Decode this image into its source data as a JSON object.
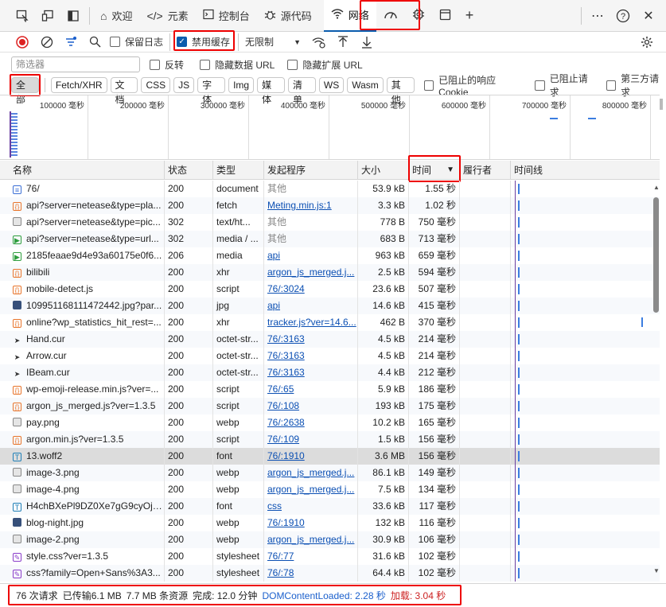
{
  "tabs": [
    {
      "label": "欢迎",
      "icon": "home-icon"
    },
    {
      "label": "元素",
      "icon": "code-icon"
    },
    {
      "label": "控制台",
      "icon": "console-icon"
    },
    {
      "label": "源代码",
      "icon": "bug-icon"
    },
    {
      "label": "网络",
      "icon": "wifi-icon",
      "active": true
    },
    {
      "label": "",
      "icon": "performance-icon"
    },
    {
      "label": "",
      "icon": "memory-chip-icon"
    },
    {
      "label": "",
      "icon": "application-icon"
    },
    {
      "label": "",
      "icon": "plus-icon"
    }
  ],
  "toolbar": {
    "preserve_log": "保留日志",
    "disable_cache": "禁用缓存",
    "disable_cache_checked": true,
    "throttle": "无限制"
  },
  "filter": {
    "placeholder": "筛选器",
    "invert": "反转",
    "hide_data_url": "隐藏数据 URL",
    "hide_ext_url": "隐藏扩展 URL"
  },
  "types": [
    "全部",
    "Fetch/XHR",
    "文档",
    "CSS",
    "JS",
    "字体",
    "Img",
    "媒体",
    "清单",
    "WS",
    "Wasm",
    "其他"
  ],
  "type_options": {
    "blocked_cookies": "已阻止的响应 Cookie",
    "blocked_requests": "已阻止请求",
    "third_party": "第三方请求"
  },
  "overview_ticks": [
    "100000 毫秒",
    "200000 毫秒",
    "300000 毫秒",
    "400000 毫秒",
    "500000 毫秒",
    "600000 毫秒",
    "700000 毫秒",
    "800000 毫秒"
  ],
  "columns": {
    "name": "名称",
    "status": "状态",
    "type": "类型",
    "initiator": "发起程序",
    "size": "大小",
    "time": "时间",
    "executor": "履行者",
    "timeline": "时间线"
  },
  "rows": [
    {
      "icon": "doc",
      "name": "76/",
      "status": "200",
      "type": "document",
      "init": "其他",
      "link": false,
      "size": "53.9 kB",
      "time": "1.55 秒"
    },
    {
      "icon": "xhr",
      "name": "api?server=netease&type=pla...",
      "status": "200",
      "type": "fetch",
      "init": "Meting.min.js:1",
      "link": true,
      "size": "3.3 kB",
      "time": "1.02 秒"
    },
    {
      "icon": "img",
      "name": "api?server=netease&type=pic...",
      "status": "302",
      "type": "text/ht...",
      "init": "其他",
      "link": false,
      "size": "778 B",
      "time": "750 毫秒"
    },
    {
      "icon": "media",
      "name": "api?server=netease&type=url...",
      "status": "302",
      "type": "media / ...",
      "init": "其他",
      "link": false,
      "size": "683 B",
      "time": "713 毫秒"
    },
    {
      "icon": "media",
      "name": "2185feaae9d4e93a60175e0f6...",
      "status": "206",
      "type": "media",
      "init": "api",
      "link": true,
      "size": "963 kB",
      "time": "659 毫秒"
    },
    {
      "icon": "xhr",
      "name": "bilibili",
      "status": "200",
      "type": "xhr",
      "init": "argon_js_merged.j...",
      "link": true,
      "size": "2.5 kB",
      "time": "594 毫秒"
    },
    {
      "icon": "xhr",
      "name": "mobile-detect.js",
      "status": "200",
      "type": "script",
      "init": "76/:3024",
      "link": true,
      "size": "23.6 kB",
      "time": "507 毫秒"
    },
    {
      "icon": "jpg",
      "name": "10995116811147244​2.jpg?par...",
      "status": "200",
      "type": "jpg",
      "init": "api",
      "link": true,
      "size": "14.6 kB",
      "time": "415 毫秒"
    },
    {
      "icon": "xhr",
      "name": "online?wp_statistics_hit_rest=...",
      "status": "200",
      "type": "xhr",
      "init": "tracker.js?ver=14.6...",
      "link": true,
      "size": "462 B",
      "time": "370 毫秒"
    },
    {
      "icon": "cur",
      "name": "Hand.cur",
      "status": "200",
      "type": "octet-str...",
      "init": "76/:3163",
      "link": true,
      "size": "4.5 kB",
      "time": "214 毫秒"
    },
    {
      "icon": "cur",
      "name": "Arrow.cur",
      "status": "200",
      "type": "octet-str...",
      "init": "76/:3163",
      "link": true,
      "size": "4.5 kB",
      "time": "214 毫秒"
    },
    {
      "icon": "cur",
      "name": "IBeam.cur",
      "status": "200",
      "type": "octet-str...",
      "init": "76/:3163",
      "link": true,
      "size": "4.4 kB",
      "time": "212 毫秒"
    },
    {
      "icon": "xhr",
      "name": "wp-emoji-release.min.js?ver=...",
      "status": "200",
      "type": "script",
      "init": "76/:65",
      "link": true,
      "size": "5.9 kB",
      "time": "186 毫秒"
    },
    {
      "icon": "xhr",
      "name": "argon_js_merged.js?ver=1.3.5",
      "status": "200",
      "type": "script",
      "init": "76/:108",
      "link": true,
      "size": "193 kB",
      "time": "175 毫秒"
    },
    {
      "icon": "img",
      "name": "pay.png",
      "status": "200",
      "type": "webp",
      "init": "76/:2638",
      "link": true,
      "size": "10.2 kB",
      "time": "165 毫秒"
    },
    {
      "icon": "xhr",
      "name": "argon.min.js?ver=1.3.5",
      "status": "200",
      "type": "script",
      "init": "76/:109",
      "link": true,
      "size": "1.5 kB",
      "time": "156 毫秒"
    },
    {
      "icon": "font",
      "name": "13.woff2",
      "status": "200",
      "type": "font",
      "init": "76/:1910",
      "link": true,
      "size": "3.6 MB",
      "time": "156 毫秒",
      "selected": true
    },
    {
      "icon": "img",
      "name": "image-3.png",
      "status": "200",
      "type": "webp",
      "init": "argon_js_merged.j...",
      "link": true,
      "size": "86.1 kB",
      "time": "149 毫秒"
    },
    {
      "icon": "img",
      "name": "image-4.png",
      "status": "200",
      "type": "webp",
      "init": "argon_js_merged.j...",
      "link": true,
      "size": "7.5 kB",
      "time": "134 毫秒"
    },
    {
      "icon": "font",
      "name": "H4chBXePl9DZ0Xe7gG9cyOj7...",
      "status": "200",
      "type": "font",
      "init": "css",
      "link": true,
      "size": "33.6 kB",
      "time": "117 毫秒"
    },
    {
      "icon": "jpg",
      "name": "blog-night.jpg",
      "status": "200",
      "type": "webp",
      "init": "76/:1910",
      "link": true,
      "size": "132 kB",
      "time": "116 毫秒"
    },
    {
      "icon": "img",
      "name": "image-2.png",
      "status": "200",
      "type": "webp",
      "init": "argon_js_merged.j...",
      "link": true,
      "size": "30.9 kB",
      "time": "106 毫秒"
    },
    {
      "icon": "css",
      "name": "style.css?ver=1.3.5",
      "status": "200",
      "type": "stylesheet",
      "init": "76/:77",
      "link": true,
      "size": "31.6 kB",
      "time": "102 毫秒"
    },
    {
      "icon": "css",
      "name": "css?family=Open+Sans%3A3...",
      "status": "200",
      "type": "stylesheet",
      "init": "76/:78",
      "link": true,
      "size": "64.4 kB",
      "time": "102 毫秒"
    }
  ],
  "status_bar": {
    "requests": "76 次请求",
    "transferred": "已传输6.1 MB",
    "resources": "7.7 MB 条资源",
    "finish": "完成: 12.0 分钟",
    "dcl": "DOMContentLoaded: 2.28 秒",
    "load": "加载: 3.04 秒"
  }
}
